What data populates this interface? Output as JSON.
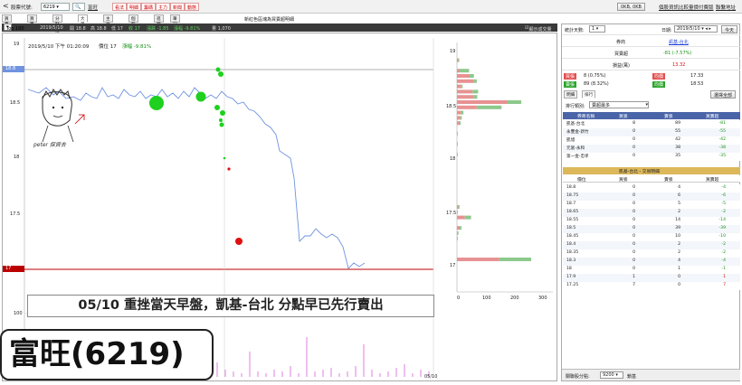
{
  "topbar": {
    "back_glyph": "<",
    "stock_label": "股票代號:",
    "stock_code": "6219",
    "stock_link": "富旺",
    "red_buttons": [
      "看法",
      "明細",
      "籌碼",
      "主力",
      "新聞",
      "動態"
    ],
    "units_button": "0KB, 0KB",
    "links": [
      "個股資訊",
      "比較量價",
      "付費版",
      "聯繫地址"
    ]
  },
  "tabs": [
    "買賣分點",
    "買賣走勢",
    "分點K線",
    "大單券商",
    "主力動態",
    "個股分析",
    "進階",
    "筆記"
  ],
  "center_title": "新紅色區塊為買賣超明細",
  "infobar": {
    "top_select": "Top 100",
    "date": "2019/5/10",
    "open": "開 18.8",
    "high": "高 18.8",
    "low": "低 17",
    "close": "收 17",
    "change": "漲跌 -1.85",
    "pct": "漲幅 -9.81%",
    "volume": "量 1,070",
    "checkbox_label": "顯示成交量"
  },
  "chart": {
    "cursor_text": "2019/5/10 下午 01:20:09",
    "price_text": "價位 17",
    "change_text": "漲幅 -9.81%",
    "y_ticks": [
      "19",
      "18.5",
      "18",
      "17.5",
      "17"
    ],
    "y_tag_high": "18.8",
    "y_tag_low": "17",
    "vol_ticks": [
      "100",
      "0"
    ],
    "date_tag": "05/10"
  },
  "hist": {
    "y_ticks": [
      "19",
      "18.5",
      "18",
      "17.5",
      "17"
    ],
    "x_ticks": [
      "0",
      "100",
      "200",
      "300"
    ],
    "chart_data": {
      "type": "bar",
      "note_series": [
        "買張",
        "賣張"
      ],
      "categories": [
        "18.9",
        "18.8",
        "18.75",
        "18.7",
        "18.65",
        "18.6",
        "18.55",
        "18.5",
        "18.45",
        "18.4",
        "18.35",
        "18.3",
        "18.2",
        "18.1",
        "18.0",
        "17.5",
        "17.45",
        "17.4",
        "17.3",
        "17.25",
        "17.2",
        "17.0"
      ],
      "series": [
        {
          "name": "buy",
          "values": [
            5,
            8,
            45,
            60,
            15,
            55,
            60,
            178,
            70,
            15,
            12,
            8,
            2,
            2,
            2,
            5,
            2,
            28,
            10,
            3,
            2,
            150
          ]
        },
        {
          "name": "sell",
          "values": [
            3,
            35,
            15,
            10,
            5,
            20,
            12,
            50,
            88,
            8,
            5,
            5,
            1,
            1,
            1,
            4,
            1,
            22,
            6,
            2,
            1,
            113
          ]
        }
      ],
      "xlim": [
        0,
        340
      ]
    }
  },
  "caption": "05/10 重挫當天早盤，凱基-台北 分點早已先行賣出",
  "stock_title": "富旺(6219)",
  "watermark": "peter 探資去",
  "right": {
    "stat_label": "統計天數:",
    "stat_value": "1",
    "date_label": "日期:",
    "date_value": "2019/5/10",
    "today_btn": "今天",
    "broker_row_label": "券商",
    "broker_name": "凱基-台北",
    "net_label": "買賣超",
    "net_value": "-81 (-7.57%)",
    "profit_label": "損益(萬)",
    "profit_value": "13.32",
    "buy_label": "買張",
    "buy_value": "8 (0.75%)",
    "buy_avg_label": "均價",
    "buy_avg": "17.33",
    "sell_label": "賣張",
    "sell_value": "89 (8.32%)",
    "sell_avg_label": "均價",
    "sell_avg": "18.53",
    "subtabs": [
      "明細",
      "排行"
    ],
    "select_all": "選擇全部",
    "rank_label": "排行類別:",
    "rank_value": "賣超最多",
    "rank_headers": [
      "券商名稱",
      "買張",
      "賣張",
      "買賣超"
    ],
    "rank_rows": [
      [
        "凱基-台北",
        "8",
        "89",
        "-81"
      ],
      [
        "永豐金-新竹",
        "0",
        "55",
        "-55"
      ],
      [
        "凱旭",
        "0",
        "42",
        "-42"
      ],
      [
        "元富-永和",
        "0",
        "38",
        "-38"
      ],
      [
        "第一金-忠孝",
        "0",
        "35",
        "-35"
      ]
    ],
    "detail_title": "凱基-台北 - 交易明細",
    "detail_headers": [
      "價位",
      "買張",
      "賣張",
      "買賣超"
    ],
    "detail_rows": [
      [
        "18.8",
        "0",
        "4",
        "-4"
      ],
      [
        "18.75",
        "0",
        "6",
        "-6"
      ],
      [
        "18.7",
        "0",
        "5",
        "-5"
      ],
      [
        "18.65",
        "0",
        "2",
        "-2"
      ],
      [
        "18.55",
        "0",
        "14",
        "-14"
      ],
      [
        "18.5",
        "0",
        "39",
        "-39"
      ],
      [
        "18.45",
        "0",
        "10",
        "-10"
      ],
      [
        "18.4",
        "0",
        "2",
        "-2"
      ],
      [
        "18.35",
        "0",
        "2",
        "-2"
      ],
      [
        "18.3",
        "0",
        "4",
        "-4"
      ],
      [
        "18",
        "0",
        "1",
        "-1"
      ],
      [
        "17.9",
        "1",
        "0",
        "1"
      ],
      [
        "17.25",
        "7",
        "0",
        "7"
      ]
    ],
    "bottom_label": "關聯股分點:",
    "bottom_code": "9200",
    "bottom_text": "鎖基"
  },
  "colors": {
    "buy_bar": "#e79292",
    "sell_bar": "#8cc98c",
    "line": "#6f93e0",
    "hdr_blue": "#4a64a8",
    "red": "#d01010",
    "green": "#189218"
  }
}
